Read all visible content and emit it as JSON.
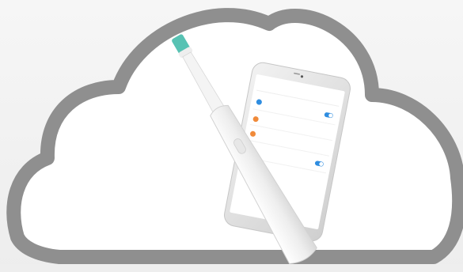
{
  "image": {
    "subject": "electric-toothbrush-and-phone-in-cloud-frame",
    "colors": {
      "background": "#f3f3f3",
      "cloud_outline": "#8f8f8f",
      "cloud_fill": "#ffffff",
      "bristles": "#57c2b3",
      "toothbrush_body": "#f1f2f2",
      "phone_frame": "#dcdcdc",
      "phone_screen": "#ffffff",
      "accent_blue": "#2f8de0",
      "accent_orange": "#f08a3a"
    }
  },
  "phone_screen": {
    "title": "",
    "rows": [
      {
        "icon": "blue-dot-icon",
        "text": "",
        "toggle": true
      },
      {
        "icon": "orange-dot-icon",
        "text": ""
      },
      {
        "icon": "orange-dot-icon",
        "text": ""
      },
      {
        "icon": "",
        "text": "",
        "toggle": true
      },
      {
        "icon": "",
        "text": ""
      }
    ]
  }
}
